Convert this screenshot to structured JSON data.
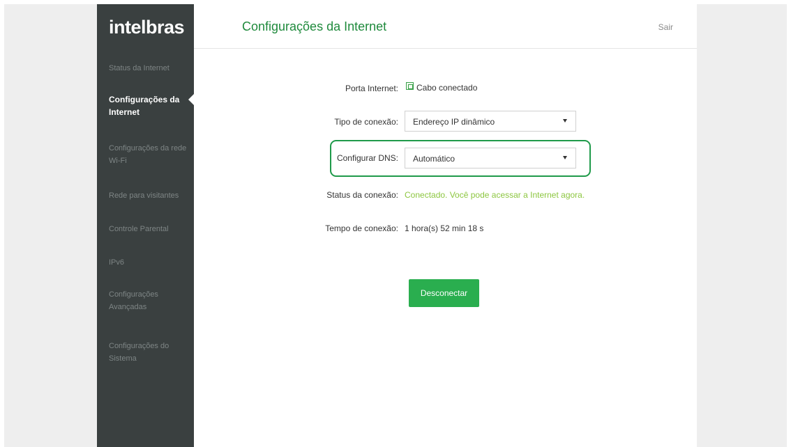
{
  "brand": {
    "logo_text": "intelbras"
  },
  "header": {
    "title": "Configurações da Internet",
    "logout_label": "Sair"
  },
  "sidebar": {
    "items": [
      {
        "label": "Status da Internet",
        "active": false
      },
      {
        "label": "Configurações da Internet",
        "active": true
      },
      {
        "label": "Configurações da rede Wi-Fi",
        "active": false
      },
      {
        "label": "Rede para visitantes",
        "active": false
      },
      {
        "label": "Controle Parental",
        "active": false
      },
      {
        "label": "IPv6",
        "active": false
      },
      {
        "label": "Configurações Avançadas",
        "active": false
      },
      {
        "label": "Configurações do Sistema",
        "active": false
      }
    ]
  },
  "form": {
    "port": {
      "label": "Porta Internet:",
      "value": "Cabo conectado"
    },
    "connection_type": {
      "label": "Tipo de conexão:",
      "value": "Endereço IP dinâmico"
    },
    "dns": {
      "label": "Configurar DNS:",
      "value": "Automático"
    },
    "status": {
      "label": "Status da conexão:",
      "value": "Conectado. Você pode acessar a Internet agora."
    },
    "uptime": {
      "label": "Tempo de conexão:",
      "value": "1 hora(s) 52 min 18 s"
    }
  },
  "actions": {
    "disconnect_label": "Desconectar"
  },
  "colors": {
    "sidebar_bg": "#3a4040",
    "accent_green": "#1f8a3c",
    "button_green": "#2aae4f",
    "status_green": "#8cc63f"
  }
}
